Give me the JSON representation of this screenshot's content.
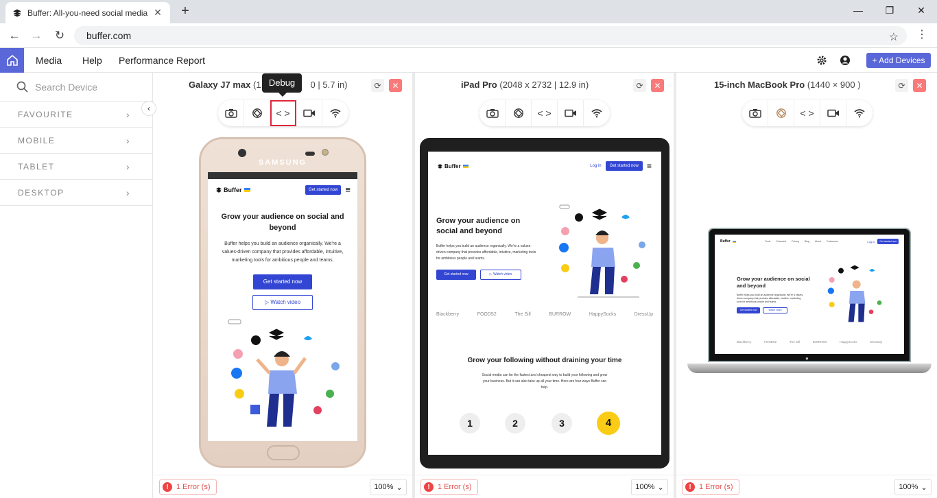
{
  "browser": {
    "tab_title": "Buffer: All-you-need social media",
    "url": "buffer.com"
  },
  "app": {
    "menu": [
      "Media",
      "Help",
      "Performance Report"
    ],
    "add_devices": "+ Add Devices",
    "colors": {
      "accent": "#5a67d8",
      "error": "#ef4444",
      "close": "#f87a7a"
    }
  },
  "sidebar": {
    "search_placeholder": "Search Device",
    "categories": [
      "FAVOURITE",
      "MOBILE",
      "TABLET",
      "DESKTOP"
    ]
  },
  "tooltip": "Debug",
  "panes": [
    {
      "name": "Galaxy J7 max",
      "spec": "(1……0 | 5.7 in)",
      "spec_visible": "(1",
      "spec_tail": "0 | 5.7 in)",
      "errors": "1 Error (s)",
      "zoom": "100%"
    },
    {
      "name": "iPad Pro",
      "spec": "(2048 x 2732 | 12.9 in)",
      "errors": "1 Error (s)",
      "zoom": "100%"
    },
    {
      "name": "15-inch MacBook Pro",
      "spec": "(1440 × 900 )",
      "errors": "1 Error (s)",
      "zoom": "100%"
    }
  ],
  "site": {
    "logo": "Buffer",
    "cta": "Get started now",
    "login": "Log in",
    "watch": "Watch video",
    "headline": "Grow your audience on social and beyond",
    "body": "Buffer helps you build an audience organically. We're a values-driven company that provides affordable, intuitive, marketing tools for ambitious people and teams.",
    "section2_title": "Grow your following without draining your time",
    "section2_body": "Social media can be the fastest and cheapest way to build your following and grow your business. But it can also take up all your time. Here are four ways Buffer can help.",
    "brands": [
      "Blackberry",
      "FOOD52",
      "The Sill",
      "BURROW",
      "HappySocks",
      "DressUp"
    ],
    "steps": [
      "1",
      "2",
      "3",
      "4"
    ],
    "phone_brand": "SAMSUNG",
    "laptop_nav": [
      "Tools",
      "Channels",
      "Pricing",
      "Blog",
      "About",
      "Customers"
    ]
  }
}
